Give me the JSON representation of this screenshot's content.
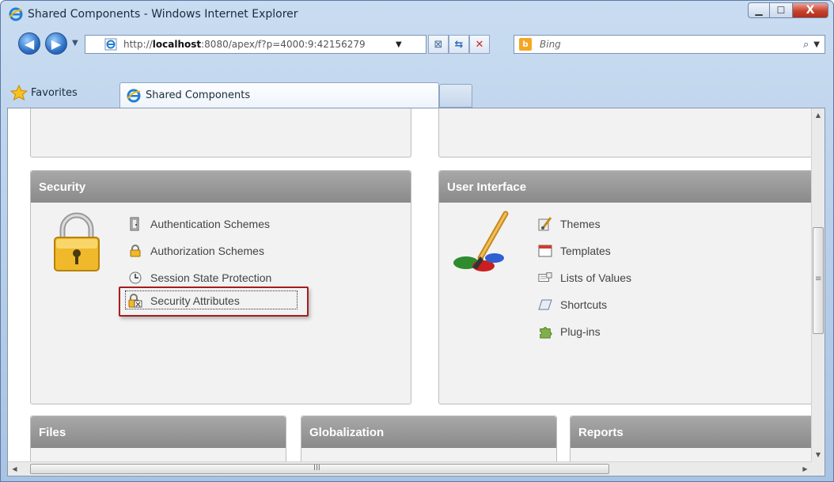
{
  "window": {
    "title": "Shared Components - Windows Internet Explorer",
    "min_glyph": "▁",
    "max_glyph": "☐",
    "close_glyph": "X"
  },
  "toolbar": {
    "url_prefix": "http://",
    "url_host": "localhost",
    "url_rest": ":8080/apex/f?p=4000:9:42156279",
    "search_placeholder": "Bing",
    "back_glyph": "◀",
    "fwd_glyph": "▶",
    "dropdown_glyph": "▼",
    "compat_glyph": "⊠",
    "refresh_glyph": "⇆",
    "stop_glyph": "✕",
    "search_glyph": "⌕"
  },
  "favbar": {
    "favorites_label": "Favorites",
    "tab_label": "Shared Components"
  },
  "panels": {
    "security": {
      "title": "Security",
      "links": [
        {
          "label": "Authentication Schemes",
          "icon": "door-icon"
        },
        {
          "label": "Authorization Schemes",
          "icon": "lock-small-icon"
        },
        {
          "label": "Session State Protection",
          "icon": "clock-icon"
        },
        {
          "label": "Security Attributes",
          "icon": "security-attributes-icon"
        }
      ]
    },
    "ui": {
      "title": "User Interface",
      "links": [
        {
          "label": "Themes",
          "icon": "theme-brush-icon"
        },
        {
          "label": "Templates",
          "icon": "template-icon"
        },
        {
          "label": "Lists of Values",
          "icon": "lov-icon"
        },
        {
          "label": "Shortcuts",
          "icon": "shortcut-icon"
        },
        {
          "label": "Plug-ins",
          "icon": "puzzle-icon"
        }
      ]
    },
    "files": {
      "title": "Files"
    },
    "globalization": {
      "title": "Globalization"
    },
    "reports": {
      "title": "Reports"
    }
  },
  "colors": {
    "highlight_border": "#a51d1d",
    "panel_header": "#999999"
  }
}
